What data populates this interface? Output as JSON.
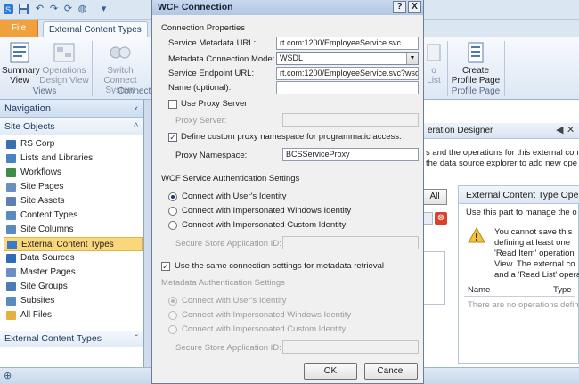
{
  "ribbon": {
    "file_tab": "File",
    "active_tab": "External Content Types",
    "buttons": {
      "summary_view": "Summary\nView",
      "operations_design_view": "Operations\nDesign View",
      "switch_connection_system": "Switch Connect\nSystem",
      "to_list": "o\nList",
      "create_profile_page": "Create\nProfile Page"
    },
    "groups": {
      "views": "Views",
      "connection": "Connectio",
      "profile_page": "Profile Page"
    }
  },
  "navigation": {
    "header": "Navigation",
    "site_objects_header": "Site Objects",
    "items": [
      {
        "label": "RS Corp",
        "color": "#3a6fb0"
      },
      {
        "label": "Lists and Libraries",
        "color": "#4a83c4"
      },
      {
        "label": "Workflows",
        "color": "#3c8c4a"
      },
      {
        "label": "Site Pages",
        "color": "#6b8fc0"
      },
      {
        "label": "Site Assets",
        "color": "#5d7fb2"
      },
      {
        "label": "Content Types",
        "color": "#5a8ac0"
      },
      {
        "label": "Site Columns",
        "color": "#5a8ac0"
      },
      {
        "label": "External Content Types",
        "color": "#3a78c8"
      },
      {
        "label": "Data Sources",
        "color": "#2e6bb8"
      },
      {
        "label": "Master Pages",
        "color": "#6b8fc0"
      },
      {
        "label": "Site Groups",
        "color": "#4a7bb5"
      },
      {
        "label": "Subsites",
        "color": "#5a8ac0"
      },
      {
        "label": "All Files",
        "color": "#e3b241"
      }
    ],
    "selected_index": 7,
    "footer_section": "External Content Types"
  },
  "designer": {
    "title": "eration Designer",
    "description_line1": "s and the operations for this external con",
    "description_line2": "the data source explorer to add new ope",
    "all_button": "All",
    "panel_title": "External Content Type Oper",
    "panel_subtitle": "Use this part to manage the o",
    "warning_line1": "You cannot save this",
    "warning_line2": "defining at least one",
    "warning_line3": "'Read Item' operation",
    "warning_line4": "View. The external co",
    "warning_line5": "and a 'Read List' opera",
    "table_col_name": "Name",
    "table_col_type": "Type",
    "table_empty": "There are no operations defin"
  },
  "dialog": {
    "title": "WCF Connection",
    "help_button": "?",
    "close_button": "X",
    "connection_properties_header": "Connection Properties",
    "service_metadata_url_label": "Service Metadata URL:",
    "service_metadata_url_value": "rt.com:1200/EmployeeService.svc",
    "metadata_connection_mode_label": "Metadata Connection Mode:",
    "metadata_connection_mode_value": "WSDL",
    "service_endpoint_url_label": "Service Endpoint URL:",
    "service_endpoint_url_value": "rt.com:1200/EmployeeService.svc?wsdl",
    "name_optional_label": "Name (optional):",
    "name_optional_value": "",
    "use_proxy_server_label": "Use Proxy Server",
    "proxy_server_label": "Proxy Server:",
    "define_custom_proxy_namespace_label": "Define custom proxy namespace for programmatic access.",
    "proxy_namespace_label": "Proxy Namespace:",
    "proxy_namespace_value": "BCSServiceProxy",
    "wcf_auth_header": "WCF Service Authentication Settings",
    "auth_options": [
      "Connect with User's Identity",
      "Connect with Impersonated Windows Identity",
      "Connect with Impersonated Custom Identity"
    ],
    "secure_store_app_id_label": "Secure Store Application ID:",
    "same_connection_settings_label": "Use the same connection settings for metadata retrieval",
    "metadata_auth_header": "Metadata Authentication Settings",
    "metadata_auth_options": [
      "Connect with User's Identity",
      "Connect with Impersonated Windows Identity",
      "Connect with Impersonated Custom Identity"
    ],
    "metadata_secure_store_app_id_label": "Secure Store Application ID:",
    "ok_button": "OK",
    "cancel_button": "Cancel"
  }
}
